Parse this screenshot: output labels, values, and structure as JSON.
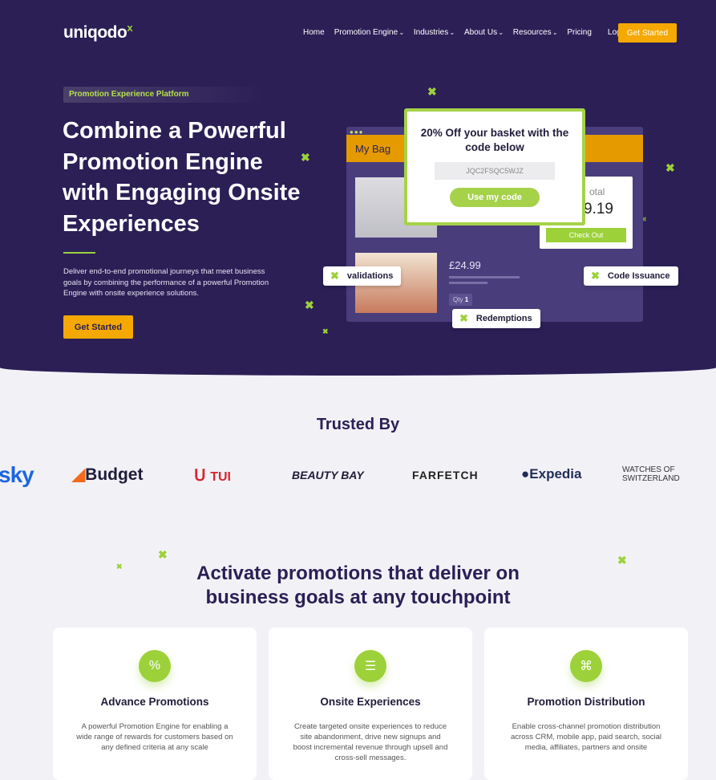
{
  "nav": {
    "logo": "uniqodo",
    "logo_mark": "x",
    "items": [
      {
        "label": "Home",
        "dropdown": false
      },
      {
        "label": "Promotion Engine",
        "dropdown": true
      },
      {
        "label": "Industries",
        "dropdown": true
      },
      {
        "label": "About Us",
        "dropdown": true
      },
      {
        "label": "Resources",
        "dropdown": true
      },
      {
        "label": "Pricing",
        "dropdown": false
      },
      {
        "label": "Login",
        "dropdown": false
      }
    ],
    "cta": "Get Started"
  },
  "hero": {
    "badge": "Promotion Experience Platform",
    "title": "Combine a Powerful Promotion Engine with Engaging Onsite Experiences",
    "description": "Deliver end-to-end promotional journeys that meet business goals by combining the performance of a powerful Promotion Engine with onsite experience solutions.",
    "cta": "Get Started"
  },
  "mockup": {
    "bag_title": "My Bag",
    "popup_title": "20% Off your basket with the code below",
    "code": "JQC2FSQC5WJZ",
    "use_code": "Use my code",
    "total_label": "otal",
    "total_amount": "9.19",
    "checkout": "Check Out",
    "price": "£24.99",
    "qty_label": "Qty",
    "qty": "1",
    "chips": [
      "validations",
      "Code Issuance",
      "Redemptions"
    ]
  },
  "trusted": {
    "title": "Trusted By",
    "logos": [
      "sky",
      "Budget",
      "TUI",
      "BEAUTY BAY",
      "FARFETCH",
      "Expedia",
      "WATCHES OF SWITZERLAND"
    ]
  },
  "features": {
    "title": "Activate promotions that deliver on business goals at any touchpoint",
    "cards": [
      {
        "icon": "percent-badge-icon",
        "title": "Advance Promotions",
        "description": "A powerful Promotion Engine for enabling a wide range of rewards for customers based on any defined criteria at any scale"
      },
      {
        "icon": "checklist-icon",
        "title": "Onsite Experiences",
        "description": "Create targeted onsite experiences to reduce site abandonment, drive new signups and boost incremental revenue through upsell and cross-sell messages."
      },
      {
        "icon": "network-icon",
        "title": "Promotion Distribution",
        "description": "Enable cross-channel promotion distribution across CRM, mobile app, paid search, social media, affiliates, partners and onsite"
      }
    ]
  },
  "colors": {
    "hero_bg": "#2b1f56",
    "accent_green": "#9cd13a",
    "cta_orange": "#f5a800"
  }
}
